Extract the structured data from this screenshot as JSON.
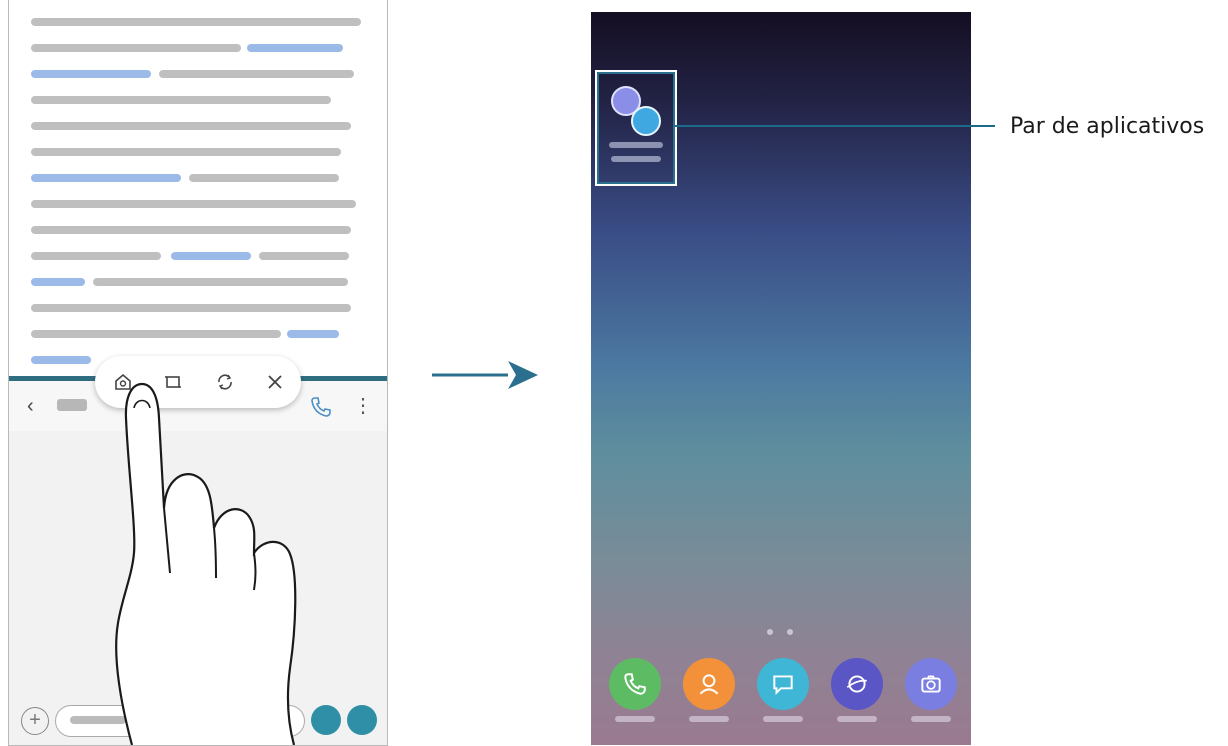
{
  "callout": {
    "label": "Par de aplicativos"
  },
  "colors": {
    "accent": "#2b6f8e",
    "divider": "#2f6e80",
    "send_button": "#2f8fa6"
  },
  "left_phone": {
    "toolbar_icons": [
      "app-pair-icon",
      "window-icon",
      "swap-icon",
      "close-icon"
    ]
  },
  "right_phone": {
    "app_pair_icons": [
      "internet-icon",
      "messages-icon"
    ],
    "dock_icons": [
      "phone-icon",
      "contacts-icon",
      "messages-icon",
      "internet-icon",
      "camera-icon"
    ]
  }
}
